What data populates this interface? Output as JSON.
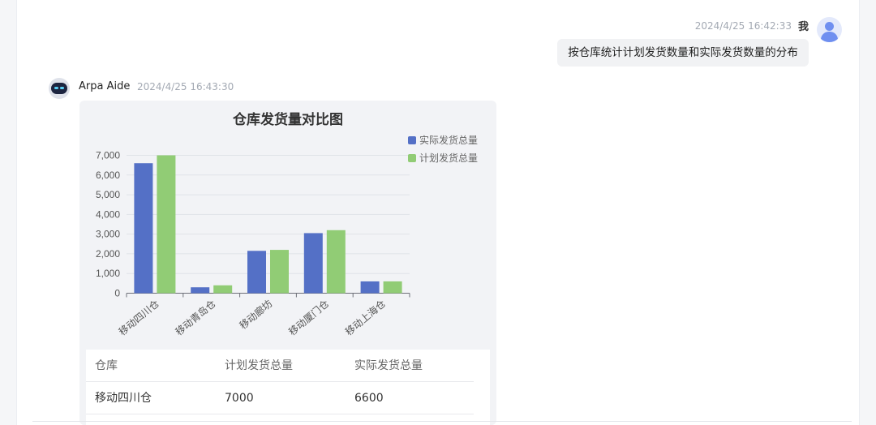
{
  "user_message": {
    "time": "2024/4/25 16:42:33",
    "name": "我",
    "text": "按仓库统计计划发货数量和实际发货数量的分布"
  },
  "bot_message": {
    "name": "Arpa Aide",
    "time": "2024/4/25 16:43:30"
  },
  "chart_data": {
    "type": "bar",
    "title": "仓库发货量对比图",
    "categories": [
      "移动四川仓",
      "移动青岛仓",
      "移动廊坊",
      "移动厦门仓",
      "移动上海仓"
    ],
    "series": [
      {
        "name": "实际发货总量",
        "color": "#5470c6",
        "values": [
          6600,
          300,
          2150,
          3050,
          600
        ]
      },
      {
        "name": "计划发货总量",
        "color": "#91cc75",
        "values": [
          7000,
          400,
          2200,
          3200,
          600
        ]
      }
    ],
    "ylim": [
      0,
      7000
    ],
    "yticks": [
      "0",
      "1,000",
      "2,000",
      "3,000",
      "4,000",
      "5,000",
      "6,000",
      "7,000"
    ],
    "grid": true,
    "legend_position": "top-right"
  },
  "table": {
    "headers": [
      "仓库",
      "计划发货总量",
      "实际发货总量"
    ],
    "rows": [
      [
        "移动四川仓",
        "7000",
        "6600"
      ]
    ]
  }
}
